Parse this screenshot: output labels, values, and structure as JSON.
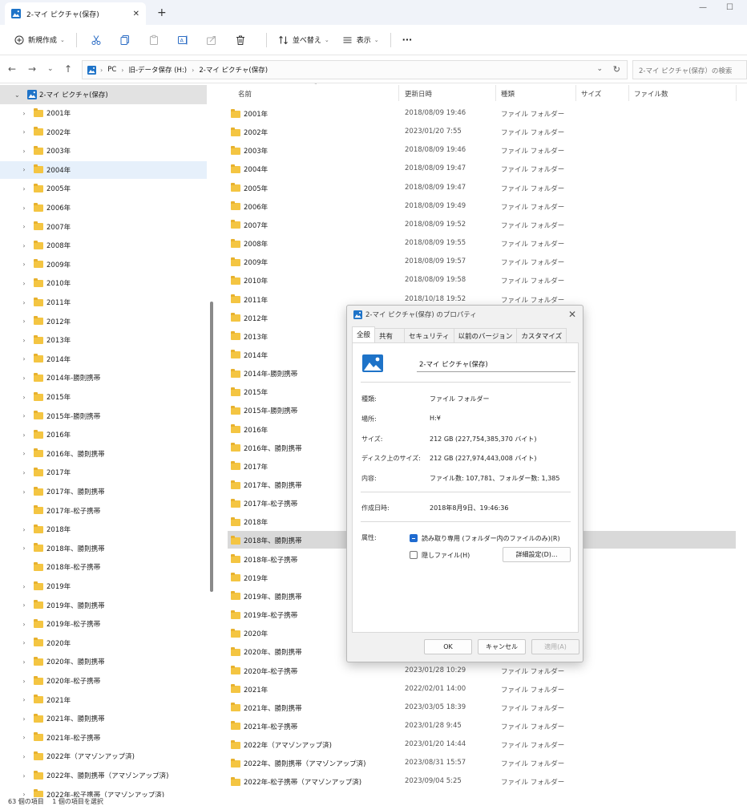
{
  "window": {
    "tab_title": "2-マイ ピクチャ(保存)",
    "new_tab": "+",
    "minimize": "—",
    "maximize": "☐"
  },
  "toolbar": {
    "new_label": "新規作成",
    "sort_label": "並べ替え",
    "view_label": "表示",
    "more": "···"
  },
  "address": {
    "crumbs": [
      "PC",
      "旧-データ保存 (H:)",
      "2-マイ ピクチャ(保存)"
    ],
    "search_placeholder": "2-マイ ピクチャ(保存）の検索"
  },
  "sidebar": {
    "root": "2-マイ ピクチャ(保存)",
    "items": [
      {
        "label": "2001年",
        "expandable": true
      },
      {
        "label": "2002年",
        "expandable": true
      },
      {
        "label": "2003年",
        "expandable": true
      },
      {
        "label": "2004年",
        "expandable": true,
        "selected": true
      },
      {
        "label": "2005年",
        "expandable": true
      },
      {
        "label": "2006年",
        "expandable": true
      },
      {
        "label": "2007年",
        "expandable": true
      },
      {
        "label": "2008年",
        "expandable": true
      },
      {
        "label": "2009年",
        "expandable": true
      },
      {
        "label": "2010年",
        "expandable": true
      },
      {
        "label": "2011年",
        "expandable": true
      },
      {
        "label": "2012年",
        "expandable": true
      },
      {
        "label": "2013年",
        "expandable": true
      },
      {
        "label": "2014年",
        "expandable": true
      },
      {
        "label": "2014年-勝則携帯",
        "expandable": true
      },
      {
        "label": "2015年",
        "expandable": true
      },
      {
        "label": "2015年-勝則携帯",
        "expandable": true
      },
      {
        "label": "2016年",
        "expandable": true
      },
      {
        "label": "2016年、勝則携帯",
        "expandable": true
      },
      {
        "label": "2017年",
        "expandable": true
      },
      {
        "label": "2017年、勝則携帯",
        "expandable": true
      },
      {
        "label": "2017年-松子携帯",
        "expandable": false
      },
      {
        "label": "2018年",
        "expandable": true
      },
      {
        "label": "2018年、勝則携帯",
        "expandable": true
      },
      {
        "label": "2018年-松子携帯",
        "expandable": false
      },
      {
        "label": "2019年",
        "expandable": true
      },
      {
        "label": "2019年、勝則携帯",
        "expandable": true
      },
      {
        "label": "2019年-松子携帯",
        "expandable": true
      },
      {
        "label": "2020年",
        "expandable": true
      },
      {
        "label": "2020年、勝則携帯",
        "expandable": true
      },
      {
        "label": "2020年-松子携帯",
        "expandable": true
      },
      {
        "label": "2021年",
        "expandable": true
      },
      {
        "label": "2021年、勝則携帯",
        "expandable": true
      },
      {
        "label": "2021年-松子携帯",
        "expandable": true
      },
      {
        "label": "2022年（アマゾンアップ済)",
        "expandable": true
      },
      {
        "label": "2022年、勝則携帯（アマゾンアップ済)",
        "expandable": true
      },
      {
        "label": "2022年-松子携帯（アマゾンアップ済)",
        "expandable": true
      }
    ]
  },
  "columns": {
    "name": "名前",
    "modified": "更新日時",
    "type": "種類",
    "size": "サイズ",
    "count": "ファイル数"
  },
  "files": [
    {
      "name": "2001年",
      "date": "2018/08/09 19:46",
      "type": "ファイル フォルダー"
    },
    {
      "name": "2002年",
      "date": "2023/01/20 7:55",
      "type": "ファイル フォルダー"
    },
    {
      "name": "2003年",
      "date": "2018/08/09 19:46",
      "type": "ファイル フォルダー"
    },
    {
      "name": "2004年",
      "date": "2018/08/09 19:47",
      "type": "ファイル フォルダー"
    },
    {
      "name": "2005年",
      "date": "2018/08/09 19:47",
      "type": "ファイル フォルダー"
    },
    {
      "name": "2006年",
      "date": "2018/08/09 19:49",
      "type": "ファイル フォルダー"
    },
    {
      "name": "2007年",
      "date": "2018/08/09 19:52",
      "type": "ファイル フォルダー"
    },
    {
      "name": "2008年",
      "date": "2018/08/09 19:55",
      "type": "ファイル フォルダー"
    },
    {
      "name": "2009年",
      "date": "2018/08/09 19:57",
      "type": "ファイル フォルダー"
    },
    {
      "name": "2010年",
      "date": "2018/08/09 19:58",
      "type": "ファイル フォルダー"
    },
    {
      "name": "2011年",
      "date": "2018/10/18 19:52",
      "type": "ファイル フォルダー"
    },
    {
      "name": "2012年",
      "date": "",
      "type": ""
    },
    {
      "name": "2013年",
      "date": "",
      "type": ""
    },
    {
      "name": "2014年",
      "date": "",
      "type": ""
    },
    {
      "name": "2014年-勝則携帯",
      "date": "",
      "type": ""
    },
    {
      "name": "2015年",
      "date": "",
      "type": ""
    },
    {
      "name": "2015年-勝則携帯",
      "date": "",
      "type": ""
    },
    {
      "name": "2016年",
      "date": "",
      "type": ""
    },
    {
      "name": "2016年、勝則携帯",
      "date": "",
      "type": ""
    },
    {
      "name": "2017年",
      "date": "",
      "type": ""
    },
    {
      "name": "2017年、勝則携帯",
      "date": "",
      "type": ""
    },
    {
      "name": "2017年-松子携帯",
      "date": "",
      "type": ""
    },
    {
      "name": "2018年",
      "date": "",
      "type": ""
    },
    {
      "name": "2018年、勝則携帯",
      "date": "",
      "type": "",
      "selected": true
    },
    {
      "name": "2018年-松子携帯",
      "date": "",
      "type": ""
    },
    {
      "name": "2019年",
      "date": "",
      "type": ""
    },
    {
      "name": "2019年、勝則携帯",
      "date": "",
      "type": ""
    },
    {
      "name": "2019年-松子携帯",
      "date": "",
      "type": ""
    },
    {
      "name": "2020年",
      "date": "",
      "type": ""
    },
    {
      "name": "2020年、勝則携帯",
      "date": "",
      "type": ""
    },
    {
      "name": "2020年-松子携帯",
      "date": "2023/01/28 10:29",
      "type": "ファイル フォルダー"
    },
    {
      "name": "2021年",
      "date": "2022/02/01 14:00",
      "type": "ファイル フォルダー"
    },
    {
      "name": "2021年、勝則携帯",
      "date": "2023/03/05 18:39",
      "type": "ファイル フォルダー"
    },
    {
      "name": "2021年-松子携帯",
      "date": "2023/01/28 9:45",
      "type": "ファイル フォルダー"
    },
    {
      "name": "2022年（アマゾンアップ済)",
      "date": "2023/01/20 14:44",
      "type": "ファイル フォルダー"
    },
    {
      "name": "2022年、勝則携帯（アマゾンアップ済)",
      "date": "2023/08/31 15:57",
      "type": "ファイル フォルダー"
    },
    {
      "name": "2022年-松子携帯（アマゾンアップ済)",
      "date": "2023/09/04 5:25",
      "type": "ファイル フォルダー"
    }
  ],
  "status": {
    "text": "63 個の項目　 1 個の項目を選択"
  },
  "dialog": {
    "title": "2-マイ ピクチャ(保存) のプロパティ",
    "tabs": [
      "全般",
      "共有",
      "セキュリティ",
      "以前のバージョン",
      "カスタマイズ"
    ],
    "folder_name": "2-マイ ピクチャ(保存)",
    "type_label": "種類:",
    "type_value": "ファイル フォルダー",
    "location_label": "場所:",
    "location_value": "H:¥",
    "size_label": "サイズ:",
    "size_value": "212 GB (227,754,385,370 バイト)",
    "disk_size_label": "ディスク上のサイズ:",
    "disk_size_value": "212 GB (227,974,443,008 バイト)",
    "contents_label": "内容:",
    "contents_value": "ファイル数: 107,781、フォルダー数: 1,385",
    "created_label": "作成日時:",
    "created_value": "2018年8月9日、19:46:36",
    "attributes_label": "属性:",
    "readonly_label": "読み取り専用 (フォルダー内のファイルのみ)(R)",
    "hidden_label": "隠しファイル(H)",
    "advanced_label": "詳細設定(D)...",
    "ok_label": "OK",
    "cancel_label": "キャンセル",
    "apply_label": "適用(A)"
  }
}
